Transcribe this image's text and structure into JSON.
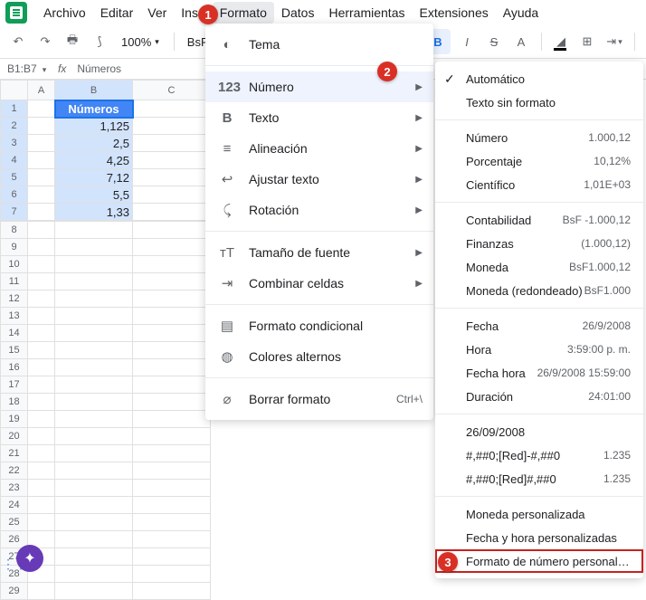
{
  "menubar": {
    "items": [
      "Archivo",
      "Editar",
      "Ver",
      "Inse",
      "Formato",
      "Datos",
      "Herramientas",
      "Extensiones",
      "Ayuda"
    ]
  },
  "toolbar": {
    "zoom": "100%",
    "currency_prefix": "BsF"
  },
  "toolbar_right": {
    "bold": "B",
    "italic": "I",
    "strike": "S",
    "textA": "A"
  },
  "namebox": {
    "ref": "B1:B7",
    "formula": "Números"
  },
  "columns": [
    "A",
    "B",
    "C"
  ],
  "rows": {
    "header": "Números",
    "values": [
      "1,125",
      "2,5",
      "4,25",
      "7,12",
      "5,5",
      "1,33"
    ]
  },
  "format_menu": {
    "theme": "Tema",
    "number": "Número",
    "text": "Texto",
    "align": "Alineación",
    "wrap": "Ajustar texto",
    "rotate": "Rotación",
    "fontsize": "Tamaño de fuente",
    "merge": "Combinar celdas",
    "cond": "Formato condicional",
    "altcolors": "Colores alternos",
    "clear": "Borrar formato",
    "clear_shortcut": "Ctrl+\\"
  },
  "number_menu": {
    "auto": "Automático",
    "plain": "Texto sin formato",
    "number_l": "Número",
    "number_e": "1.000,12",
    "percent_l": "Porcentaje",
    "percent_e": "10,12%",
    "sci_l": "Científico",
    "sci_e": "1,01E+03",
    "acct_l": "Contabilidad",
    "acct_e": "BsF -1.000,12",
    "fin_l": "Finanzas",
    "fin_e": "(1.000,12)",
    "curr_l": "Moneda",
    "curr_e": "BsF1.000,12",
    "currr_l": "Moneda (redondeado)",
    "currr_e": "BsF1.000",
    "date_l": "Fecha",
    "date_e": "26/9/2008",
    "time_l": "Hora",
    "time_e": "3:59:00 p. m.",
    "dt_l": "Fecha hora",
    "dt_e": "26/9/2008 15:59:00",
    "dur_l": "Duración",
    "dur_e": "24:01:00",
    "cust1_l": "26/09/2008",
    "cust1_e": "",
    "cust2_l": "#,##0;[Red]-#,##0",
    "cust2_e": "1.235",
    "cust3_l": "#,##0;[Red]#,##0",
    "cust3_e": "1.235",
    "ccurr": "Moneda personalizada",
    "cdt": "Fecha y hora personalizadas",
    "cnum": "Formato de número personalizado"
  },
  "markers": {
    "m1": "1",
    "m2": "2",
    "m3": "3"
  }
}
